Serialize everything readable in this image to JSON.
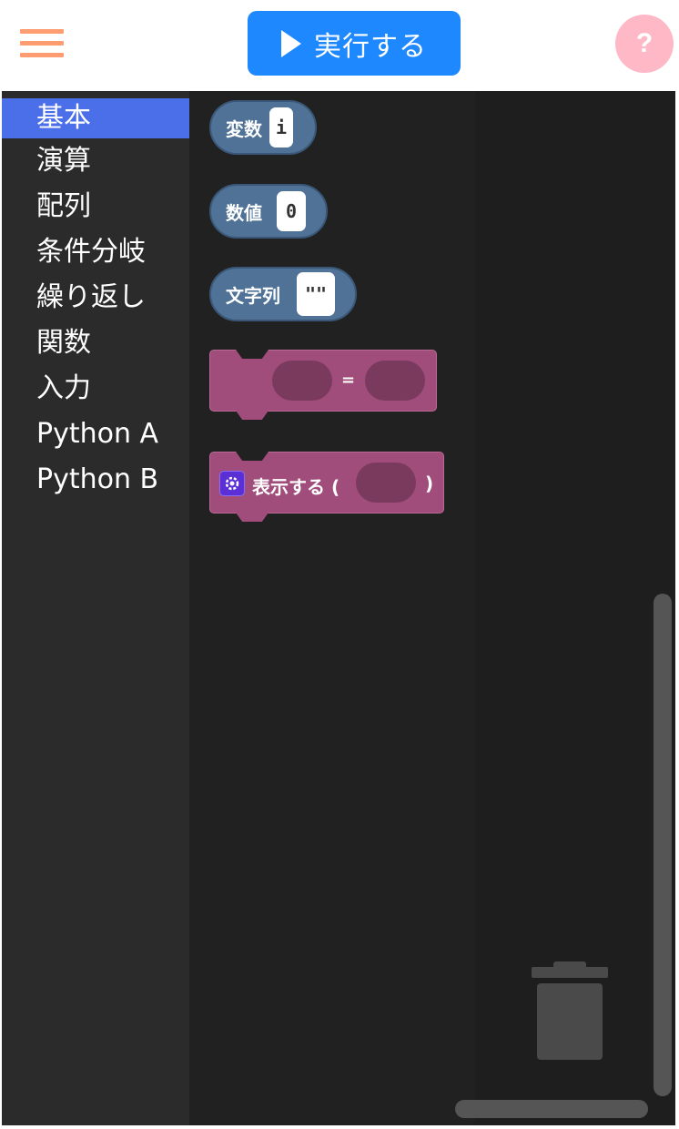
{
  "header": {
    "menu_icon": "hamburger-menu-icon",
    "run_button_label": "実行する",
    "help_label": "?"
  },
  "toolbox": {
    "categories": [
      {
        "label": "基本",
        "selected": true
      },
      {
        "label": "演算",
        "selected": false
      },
      {
        "label": "配列",
        "selected": false
      },
      {
        "label": "条件分岐",
        "selected": false
      },
      {
        "label": "繰り返し",
        "selected": false
      },
      {
        "label": "関数",
        "selected": false
      },
      {
        "label": "入力",
        "selected": false
      },
      {
        "label": "Python A",
        "selected": false
      },
      {
        "label": "Python B",
        "selected": false
      }
    ]
  },
  "flyout": {
    "variable_block": {
      "label": "変数",
      "value": "i"
    },
    "number_block": {
      "label": "数値",
      "value": "0"
    },
    "string_block": {
      "label": "文字列",
      "value": "\"\""
    },
    "assign_block": {
      "operator": "="
    },
    "print_block": {
      "label": "表示する (",
      "close": ")"
    }
  },
  "colors": {
    "accent": "#1e88ff",
    "menu": "#ff9c72",
    "help": "#ffb8c6",
    "selected_category": "#4a6fe8",
    "value_block": "#4f7296",
    "statement_block": "#a04d7b"
  }
}
